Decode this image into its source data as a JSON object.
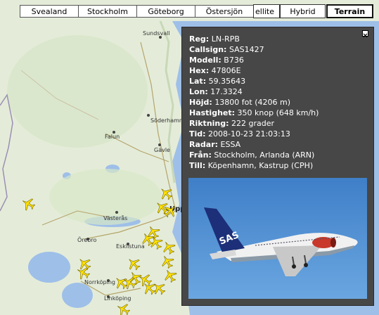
{
  "region_tabs": [
    "Svealand",
    "Stockholm",
    "Göteborg",
    "Östersjön"
  ],
  "map_types": {
    "satellite_partial": "ellite",
    "hybrid": "Hybrid",
    "terrain": "Terrain",
    "active": "terrain"
  },
  "cities": {
    "sundsvall": "Sundsvall",
    "soderhamn": "Söderhamn",
    "falun": "Falun",
    "gavle": "Gävle",
    "uppsala": "Upp",
    "vasteras": "Västerås",
    "orebro": "Örebro",
    "eskilstuna": "Eskilstuna",
    "norrkoping": "Norrköping",
    "linkoping": "Linköping"
  },
  "flight_info": {
    "reg": {
      "label": "Reg:",
      "value": "LN-RPB"
    },
    "callsign": {
      "label": "Callsign:",
      "value": "SAS1427"
    },
    "model": {
      "label": "Modell:",
      "value": "B736"
    },
    "hex": {
      "label": "Hex:",
      "value": "47806E"
    },
    "lat": {
      "label": "Lat:",
      "value": "59.35643"
    },
    "lon": {
      "label": "Lon:",
      "value": "17.3324"
    },
    "altitude": {
      "label": "Höjd:",
      "value": "13800 fot (4206 m)"
    },
    "speed": {
      "label": "Hastighet:",
      "value": "350 knop (648 km/h)"
    },
    "heading": {
      "label": "Riktning:",
      "value": "222 grader"
    },
    "time": {
      "label": "Tid:",
      "value": "2008-10-23 21:03:13"
    },
    "radar": {
      "label": "Radar:",
      "value": "ESSA"
    },
    "from": {
      "label": "Från:",
      "value": "Stockholm, Arlanda (ARN)"
    },
    "to": {
      "label": "Till:",
      "value": "Köpenhamn, Kastrup (CPH)"
    }
  },
  "photo": {
    "tail_logo": "SAS"
  },
  "colors": {
    "land": "#e4ecd9",
    "water": "#9ebfe8",
    "road": "#b5a46a",
    "plane": "#ffe100",
    "info_bg": "#474747",
    "sky": "#4a8cd1"
  }
}
